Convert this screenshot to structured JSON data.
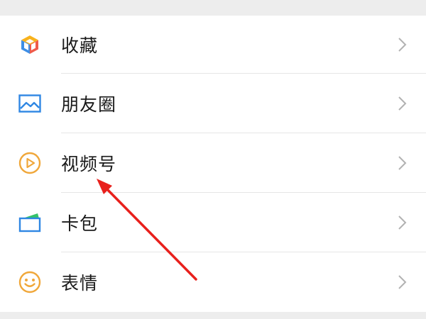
{
  "menu": {
    "items": [
      {
        "label": "收藏",
        "icon": "favorites-cube-icon"
      },
      {
        "label": "朋友圈",
        "icon": "moments-picture-icon"
      },
      {
        "label": "视频号",
        "icon": "channels-play-icon"
      },
      {
        "label": "卡包",
        "icon": "card-wallet-icon"
      },
      {
        "label": "表情",
        "icon": "sticker-smiley-icon"
      }
    ]
  },
  "colors": {
    "page_background": "#ededed",
    "list_background": "#ffffff",
    "text": "#1a1a1a",
    "chevron": "#b2b2b2",
    "annotation_arrow": "#e8201c"
  }
}
